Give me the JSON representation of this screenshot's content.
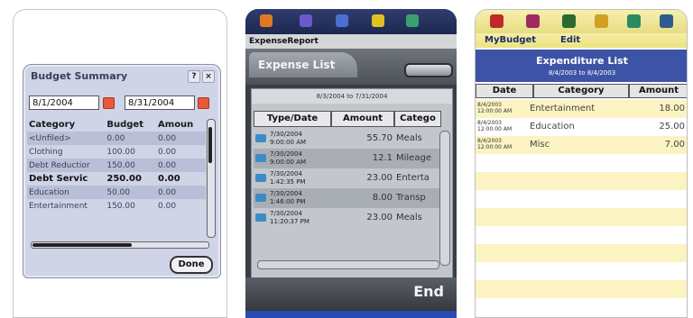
{
  "budget_summary": {
    "title": "Budget Summary",
    "help_icon_label": "?",
    "close_icon_label": "×",
    "start_date": "8/1/2004",
    "end_date": "8/31/2004",
    "columns": [
      "Category",
      "Budget",
      "Amoun"
    ],
    "rows": [
      {
        "category": "<Unfiled>",
        "budget": "0.00",
        "amount": "0.00"
      },
      {
        "category": "Clothing",
        "budget": "100.00",
        "amount": "0.00"
      },
      {
        "category": "Debt Reductior",
        "budget": "150.00",
        "amount": "0.00"
      },
      {
        "category": "Debt Servic",
        "budget": "250.00",
        "amount": "0.00"
      },
      {
        "category": "Education",
        "budget": "50.00",
        "amount": "0.00"
      },
      {
        "category": "Entertainment",
        "budget": "150.00",
        "amount": "0.00"
      }
    ],
    "done_label": "Done"
  },
  "expense_list": {
    "app_name": "ExpenseReport",
    "tab_title": "Expense List",
    "range": "8/3/2004 to 7/31/2004",
    "columns": [
      "Type/Date",
      "Amount",
      "Catego"
    ],
    "rows": [
      {
        "date": "7/30/2004",
        "time": "9:00:00 AM",
        "amount": "55.70",
        "category": "Meals"
      },
      {
        "date": "7/30/2004",
        "time": "9:00:00 AM",
        "amount": "12.1",
        "category": "Mileage"
      },
      {
        "date": "7/30/2004",
        "time": "1:42:35 PM",
        "amount": "23.00",
        "category": "Enterta"
      },
      {
        "date": "7/30/2004",
        "time": "1:46:00 PM",
        "amount": "8.00",
        "category": "Transp"
      },
      {
        "date": "7/30/2004",
        "time": "11:20:37 PM",
        "amount": "23.00",
        "category": "Meals"
      }
    ],
    "end_label": "End"
  },
  "expenditure_list": {
    "menu": [
      "MyBudget",
      "Edit"
    ],
    "title": "Expenditure List",
    "subtitle": "8/4/2003 to 8/4/2003",
    "columns": [
      "Date",
      "Category",
      "Amount"
    ],
    "rows": [
      {
        "date": "8/4/2003",
        "time": "12:00:00 AM",
        "category": "Entertainment",
        "amount": "18.00"
      },
      {
        "date": "8/4/2003",
        "time": "12:00:00 AM",
        "category": "Education",
        "amount": "25.00"
      },
      {
        "date": "8/4/2003",
        "time": "12:00:00 AM",
        "category": "Misc",
        "amount": "7.00"
      }
    ]
  },
  "colors": {
    "expense_accent": "#3a8cc4",
    "expenditure_title_band": "#3d54a6",
    "expenditure_stripe": "#fbf3c2"
  }
}
